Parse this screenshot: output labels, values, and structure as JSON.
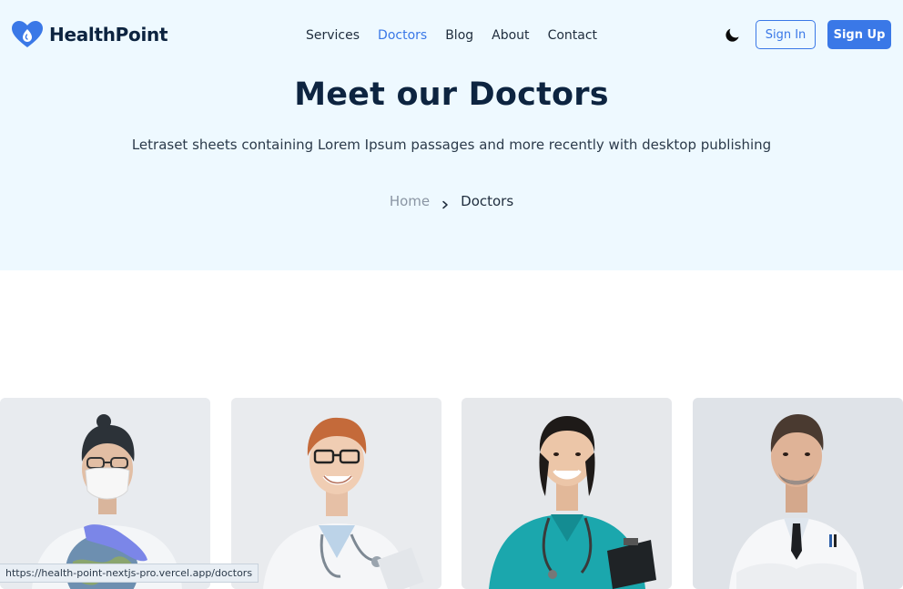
{
  "brand": {
    "name": "HealthPoint"
  },
  "nav": {
    "items": [
      {
        "label": "Services",
        "active": false
      },
      {
        "label": "Doctors",
        "active": true
      },
      {
        "label": "Blog",
        "active": false
      },
      {
        "label": "About",
        "active": false
      },
      {
        "label": "Contact",
        "active": false
      }
    ]
  },
  "auth": {
    "signin_label": "Sign In",
    "signup_label": "Sign Up"
  },
  "hero": {
    "title": "Meet our Doctors",
    "subtitle": "Letraset sheets containing Lorem Ipsum passages and more recently with desktop publishing"
  },
  "breadcrumb": {
    "home": "Home",
    "current": "Doctors"
  },
  "doctors": [
    {
      "photo": "doctor-with-mask-and-globe"
    },
    {
      "photo": "doctor-with-glasses-smiling"
    },
    {
      "photo": "nurse-in-teal-scrubs-with-clipboard"
    },
    {
      "photo": "senior-doctor-arms-crossed"
    }
  ],
  "status": {
    "url": "https://health-point-nextjs-pro.vercel.app/doctors"
  },
  "colors": {
    "accent": "#3a78e7",
    "hero_bg": "#eef9ff",
    "heading": "#0d2440"
  }
}
